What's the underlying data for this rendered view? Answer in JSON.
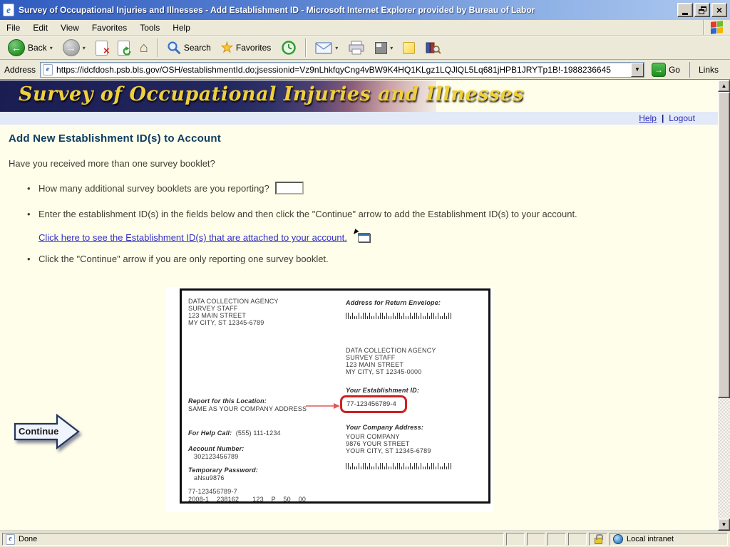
{
  "window": {
    "title": "Survey of Occupational Injuries and Illnesses - Add Establishment ID - Microsoft Internet Explorer provided by Bureau of Labor"
  },
  "menu": {
    "items": [
      "File",
      "Edit",
      "View",
      "Favorites",
      "Tools",
      "Help"
    ]
  },
  "toolbar": {
    "back": "Back",
    "search": "Search",
    "favorites": "Favorites"
  },
  "address": {
    "label": "Address",
    "url": "https://idcfdosh.psb.bls.gov/OSH/establishmentId.do;jsessionid=Vz9nLhkfqyCng4vBW9K4HQ1KLgz1LQJlQL5Lq681jHPB1JRYTp1B!-1988236645",
    "go": "Go",
    "links": "Links"
  },
  "banner": {
    "title": "Survey of Occupational Injuries and Illnesses"
  },
  "nav": {
    "help": "Help",
    "divider": "|",
    "logout": "Logout"
  },
  "page": {
    "heading": "Add New Establishment ID(s) to Account",
    "intro": "Have you received more than one survey booklet?",
    "bullet1": "How many additional survey booklets are you reporting?",
    "booklets_input_value": "",
    "bullet2": "Enter the establishment ID(s) in the fields below and then click the \"Continue\" arrow to add the Establishment ID(s) to your account.",
    "link_text": "Click here to see the Establishment ID(s) that are attached to your account.",
    "bullet3": "Click the \"Continue\" arrow if you are only reporting one survey booklet.",
    "continue_label": "Continue"
  },
  "envelope": {
    "agency_address": [
      "DATA COLLECTION AGENCY",
      "SURVEY STAFF",
      "123 MAIN STREET",
      "MY CITY, ST  12345-6789"
    ],
    "return_label": "Address for Return Envelope:",
    "recipient_address": [
      "DATA COLLECTION AGENCY",
      "SURVEY STAFF",
      "123 MAIN STREET",
      "MY CITY, ST  12345-0000"
    ],
    "establishment_id_label": "Your Establishment ID:",
    "establishment_id": "77-123456789-4",
    "report_label": "Report for this Location:",
    "report_value": "SAME AS YOUR COMPANY ADDRESS",
    "help_call_label": "For Help Call:",
    "help_call_value": "(555) 111-1234",
    "account_label": "Account Number:",
    "account_value": "302123456789",
    "password_label": "Temporary Password:",
    "password_value": "aNsu9876",
    "footer_id": "77-123456789-7",
    "footer_codes": "2008-1    238162       123    P    50    00",
    "company_label": "Your Company Address:",
    "company_address": [
      "YOUR COMPANY",
      "9876 YOUR STREET",
      "YOUR CITY, ST 12345-6789"
    ],
    "barcode_pattern": "11010010110100101101001011010010110100101101001011"
  },
  "status": {
    "text": "Done",
    "zone": "Local intranet"
  },
  "colors": {
    "title_gradient_start": "#2F5BC0",
    "title_gradient_end": "#AFC9F0",
    "chrome": "#ECE9D8",
    "page_bg": "#FFFEEA",
    "banner_bg": "#23275F",
    "banner_text": "#EFCF3A",
    "helpbar_bg": "#E2E9F7",
    "heading": "#0C3D60",
    "link": "#3030C8",
    "highlight_red": "#CC2222"
  }
}
